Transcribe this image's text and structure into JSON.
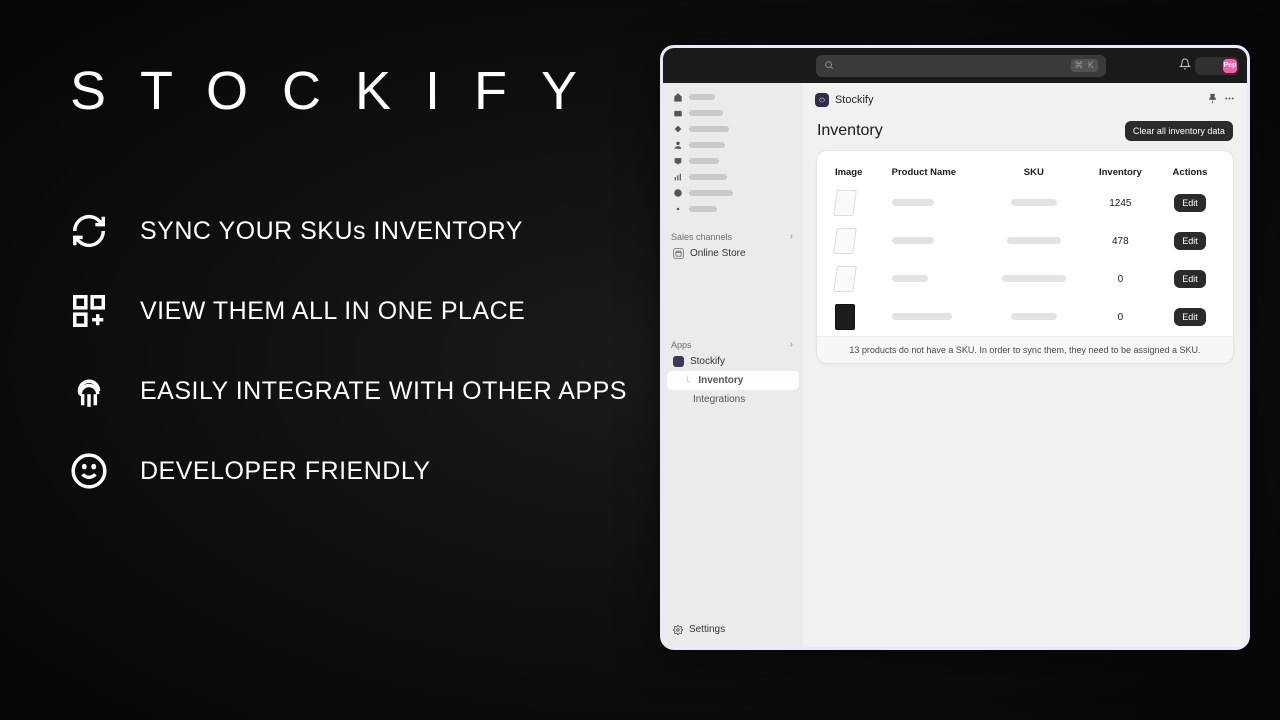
{
  "brand": "STOCKIFY",
  "features": [
    {
      "icon": "sync",
      "text": "SYNC YOUR SKUs INVENTORY"
    },
    {
      "icon": "grid",
      "text": "VIEW THEM ALL IN ONE PLACE"
    },
    {
      "icon": "cloud",
      "text": "EASILY INTEGRATE WITH OTHER APPS"
    },
    {
      "icon": "smile",
      "text": "DEVELOPER FRIENDLY"
    }
  ],
  "topbar": {
    "search_placeholder": "",
    "shortcut": "⌘ K",
    "avatar_initials": "Pep"
  },
  "sidebar": {
    "sales_channels_label": "Sales channels",
    "online_store_label": "Online Store",
    "apps_label": "Apps",
    "app_name": "Stockify",
    "app_sub": [
      {
        "label": "Inventory",
        "selected": true
      },
      {
        "label": "Integrations",
        "selected": false
      }
    ],
    "settings_label": "Settings"
  },
  "page": {
    "app_title": "Stockify",
    "heading": "Inventory",
    "clear_button": "Clear all inventory data",
    "columns": {
      "image": "Image",
      "product_name": "Product Name",
      "sku": "SKU",
      "inventory": "Inventory",
      "actions": "Actions"
    },
    "rows": [
      {
        "thumb": "light",
        "inventory": "1245",
        "action": "Edit"
      },
      {
        "thumb": "light",
        "inventory": "478",
        "action": "Edit"
      },
      {
        "thumb": "light",
        "inventory": "0",
        "action": "Edit"
      },
      {
        "thumb": "dark",
        "inventory": "0",
        "action": "Edit"
      }
    ],
    "notice": "13 products do not have a SKU. In order to sync them, they need to be assigned a SKU."
  }
}
